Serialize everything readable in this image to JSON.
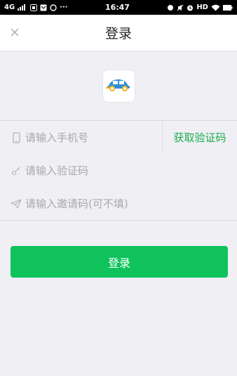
{
  "status_bar": {
    "network": "4G",
    "time": "16:47",
    "hd": "HD",
    "more": "···"
  },
  "header": {
    "title": "登录"
  },
  "form": {
    "phone_placeholder": "请输入手机号",
    "code_placeholder": "请输入验证码",
    "invite_placeholder": "请输入邀请码(可不填)",
    "get_code_label": "获取验证码"
  },
  "login_button": {
    "label": "登录"
  },
  "colors": {
    "accent": "#0fc25b",
    "link": "#1aad4a"
  },
  "icons": [
    "close-icon",
    "app-logo-icon",
    "phone-icon",
    "key-icon",
    "send-icon"
  ]
}
